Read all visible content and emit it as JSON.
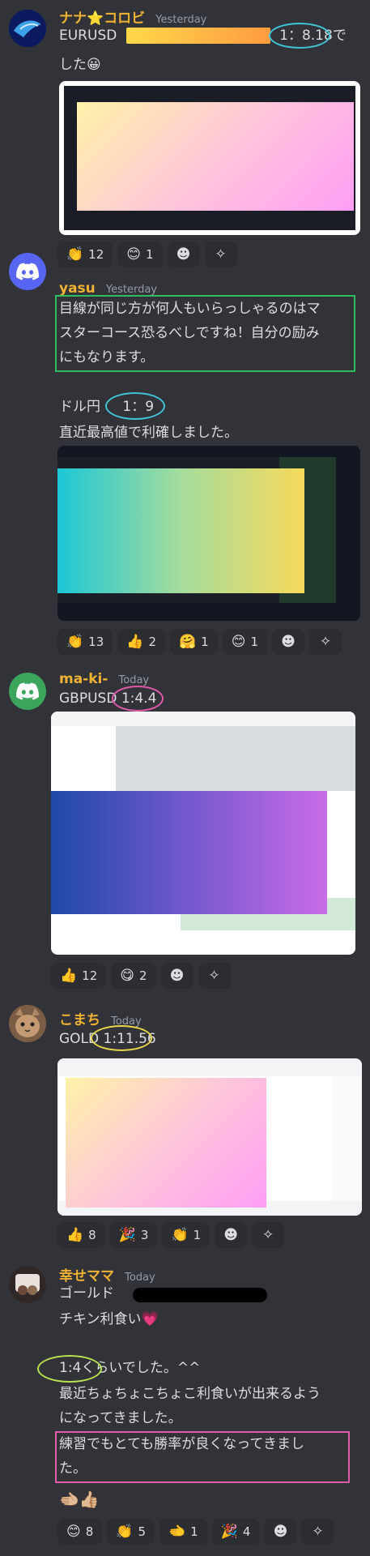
{
  "messages": [
    {
      "username": "ナナ⭐コロビ",
      "timestamp": "Yesterday",
      "lines": [
        "EURUSD",
        "1：8.18",
        "で",
        "した😀"
      ],
      "reactions": [
        {
          "emoji": "👏",
          "count": "12"
        },
        {
          "emoji": "😊",
          "count": "1"
        }
      ]
    },
    {
      "username": "yasu",
      "timestamp": "Yesterday",
      "lines": [
        "目線が同じ方が何人もいらっしゃるのはマ",
        "スターコース恐るべしですね！自分の励み",
        "にもなります。",
        "ドル円",
        "1：9",
        "直近最高値で利確しました。"
      ],
      "reactions": [
        {
          "emoji": "👏",
          "count": "13"
        },
        {
          "emoji": "👍",
          "count": "2"
        },
        {
          "emoji": "🤗",
          "count": "1"
        },
        {
          "emoji": "😊",
          "count": "1"
        }
      ]
    },
    {
      "username": "ma-ki-",
      "timestamp": "Today",
      "lines": [
        "GBPUSD 1:4.4"
      ],
      "reactions": [
        {
          "emoji": "👍",
          "count": "12"
        },
        {
          "emoji": "😋",
          "count": "2"
        }
      ]
    },
    {
      "username": "こまち",
      "timestamp": "Today",
      "lines": [
        "GOLD 1:11.56"
      ],
      "reactions": [
        {
          "emoji": "👍",
          "count": "8"
        },
        {
          "emoji": "🎉",
          "count": "3"
        },
        {
          "emoji": "👏",
          "count": "1"
        }
      ]
    },
    {
      "username": "幸せママ",
      "timestamp": "Today",
      "lines": [
        "ゴールド",
        "チキン利食い💗",
        "1:4くらいでした。^^",
        "最近ちょちょこちょこ利食いが出来るよう",
        "になってきました。",
        "練習でもとても勝率が良くなってきまし",
        "た。",
        "🫲🏼👍🏼"
      ],
      "reactions": [
        {
          "emoji": "😊",
          "count": "8"
        },
        {
          "emoji": "👏",
          "count": "5"
        },
        {
          "emoji": "🫲",
          "count": "1"
        },
        {
          "emoji": "🎉",
          "count": "4"
        }
      ]
    }
  ],
  "colors": {
    "background": "#313338",
    "username": "#f0b232",
    "ring_cyan": "#40c4d8",
    "ring_pink": "#e05aa8",
    "ring_yellow": "#e8d64a",
    "ring_lime": "#b7e34e",
    "box_green": "#2ebd5f",
    "box_pink": "#e05aa8"
  }
}
